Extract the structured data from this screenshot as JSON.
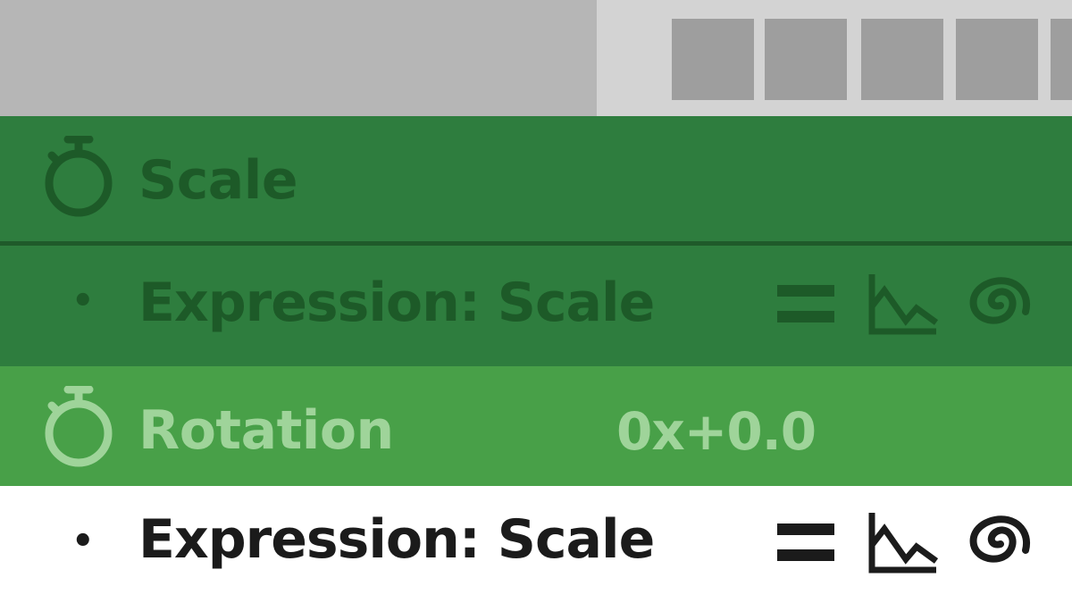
{
  "toolbar": {
    "tiles": [
      "tile",
      "tile",
      "tile",
      "tile"
    ]
  },
  "layers": [
    {
      "property": "Scale",
      "icon": "stopwatch-icon"
    },
    {
      "expression_label": "Expression: Scale",
      "bullet": "•",
      "icons": [
        "expression-enable-icon",
        "graph-icon",
        "pick-whip-icon"
      ]
    },
    {
      "property": "Rotation",
      "value": "0x+0.0",
      "icon": "stopwatch-icon"
    },
    {
      "expression_label": "Expression: Scale",
      "bullet": "•",
      "icons": [
        "expression-enable-icon",
        "graph-icon",
        "pick-whip-icon"
      ]
    }
  ],
  "colors": {
    "row_dark_green": "#2e7d3e",
    "row_light_green": "#48a048",
    "text_dark_green": "#1d5a28",
    "text_light_green": "#9fd49a",
    "text_dark": "#1b1b1b"
  }
}
